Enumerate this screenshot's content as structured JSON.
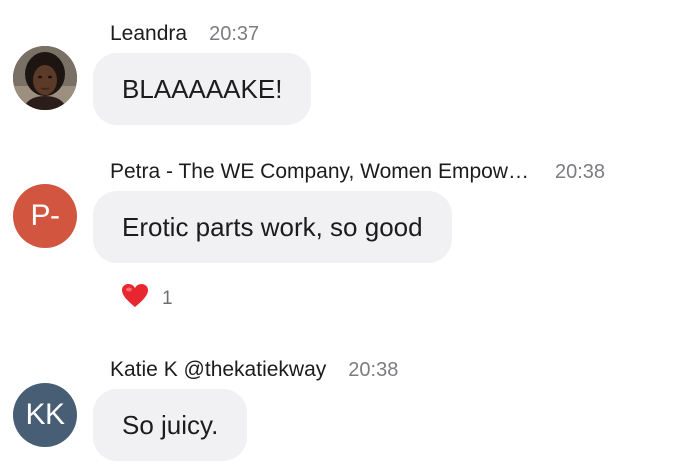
{
  "messages": [
    {
      "sender": "Leandra",
      "time": "20:37",
      "text": "BLAAAAAKE!",
      "avatar": {
        "type": "photo",
        "icon": "user-photo-avatar"
      }
    },
    {
      "sender": "Petra - The WE Company, Women Empow…",
      "time": "20:38",
      "text": "Erotic parts work, so good",
      "avatar": {
        "type": "initials",
        "initials": "P-",
        "color": "#d2553f"
      },
      "reaction": {
        "emoji": "❤️",
        "icon": "heart-icon",
        "count": "1"
      }
    },
    {
      "sender": "Katie K @thekatiekway",
      "time": "20:38",
      "text": "So juicy.",
      "avatar": {
        "type": "initials",
        "initials": "KK",
        "color": "#475e74"
      }
    }
  ]
}
